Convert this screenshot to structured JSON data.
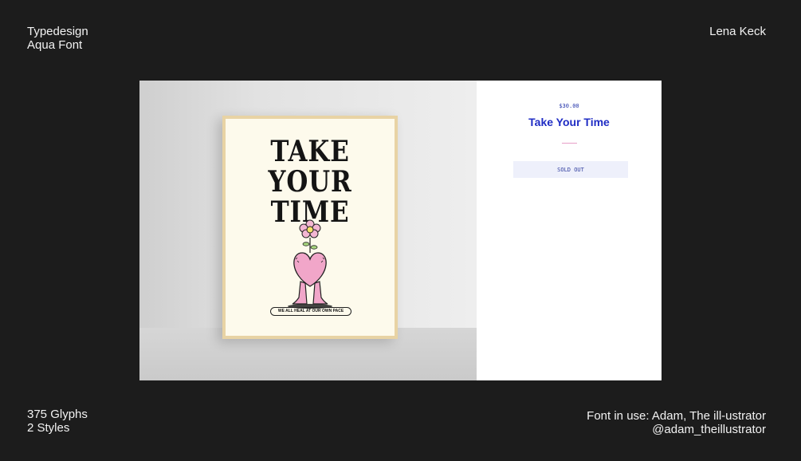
{
  "header": {
    "project_line1": "Typedesign",
    "project_line2": "Aqua Font",
    "author": "Lena Keck"
  },
  "footer": {
    "glyphs": "375 Glyphs",
    "styles": "2 Styles",
    "credit_line1": "Font in use:  Adam, The ill-ustrator",
    "credit_line2": "@adam_theillustrator"
  },
  "poster": {
    "title_lines": [
      "TAKE",
      "YOUR",
      "TIME"
    ],
    "tagline": "WE ALL HEAL AT OUR OWN PACE",
    "art_icon": "heart-character-with-flower",
    "colors": {
      "paper": "#fdfaec",
      "frame": "#e8d3a4",
      "heart": "#f1a6c9",
      "ink": "#141414"
    }
  },
  "product": {
    "price": "$30.00",
    "title": "Take Your Time",
    "status_button": "SOLD OUT",
    "colors": {
      "accent": "#1f2cc4",
      "button_bg": "#eef0fb",
      "divider": "#e79fc8"
    }
  },
  "theme": {
    "background": "#1c1c1c",
    "text": "#f2f2f2"
  }
}
